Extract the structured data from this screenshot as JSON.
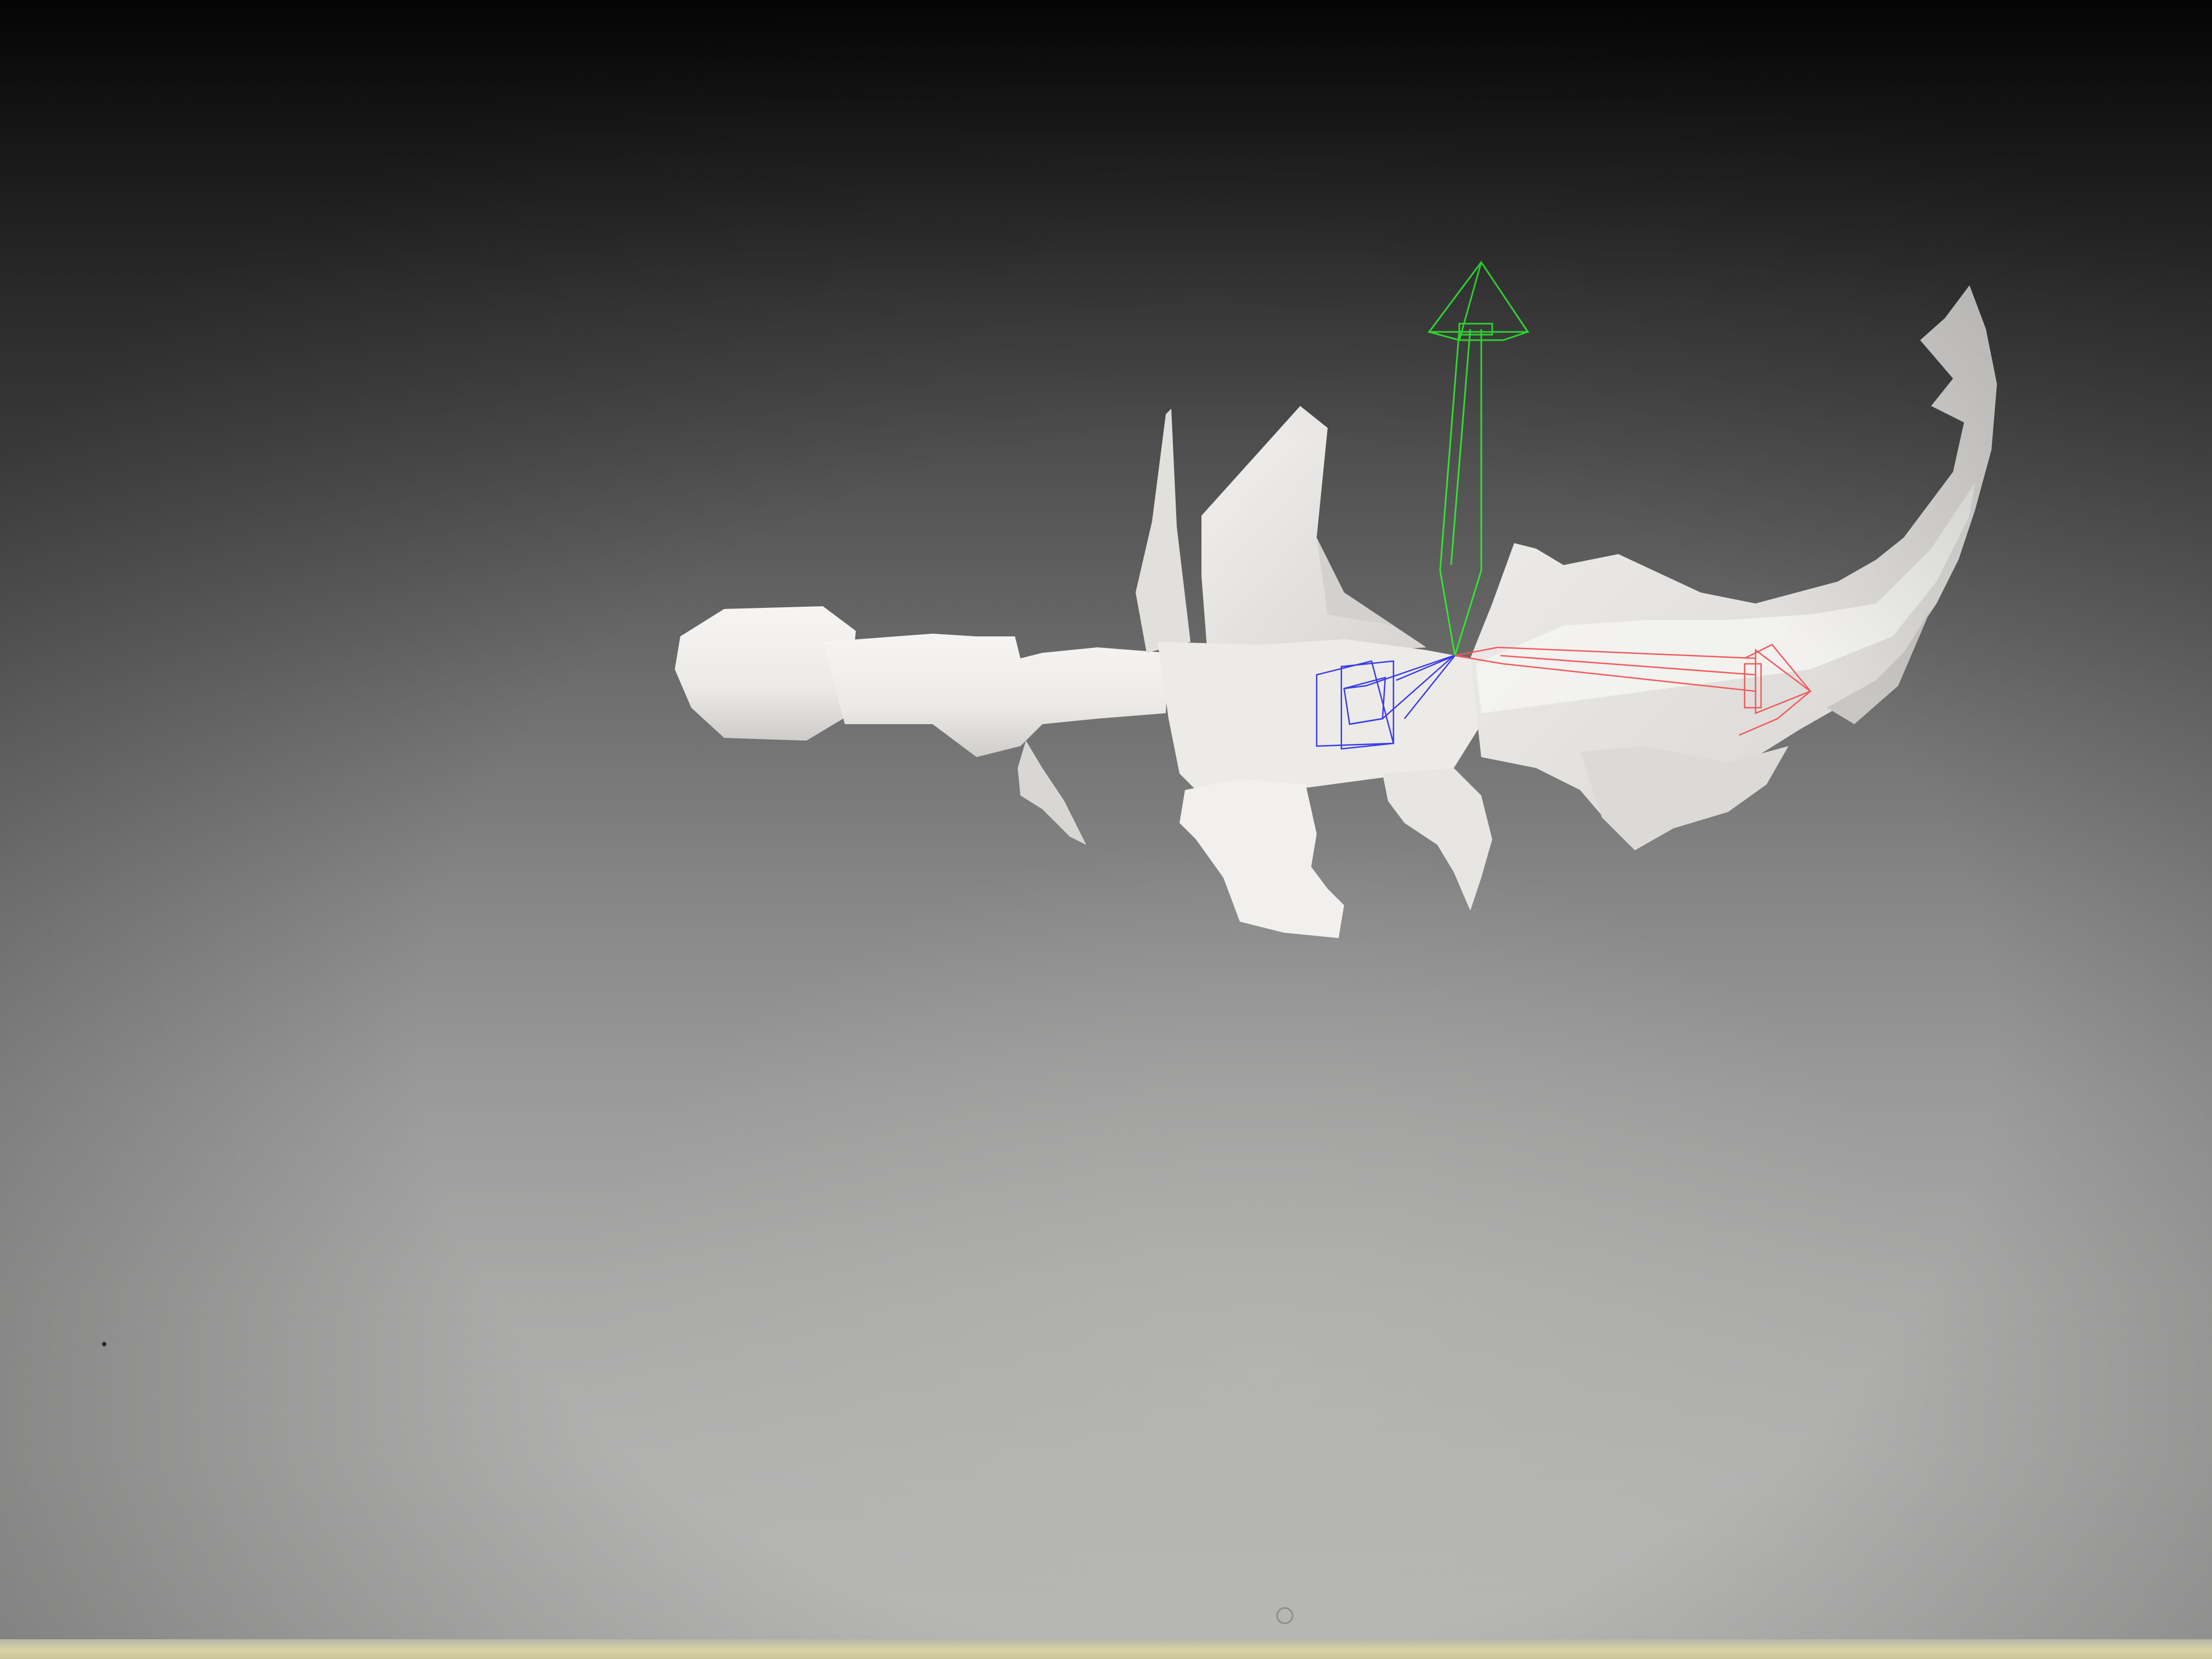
{
  "viewport": {
    "background_top": "#060606",
    "background_bottom": "#b6b6b5"
  },
  "model": {
    "icon": "scimitar-mesh",
    "color": "#efeeec",
    "shade": "#d2d0cd"
  },
  "gizmo": {
    "icon": "translate-gizmo",
    "x_axis_color": "#f05a5a",
    "y_axis_color": "#33e233",
    "z_axis_color": "#3a3ae8"
  }
}
